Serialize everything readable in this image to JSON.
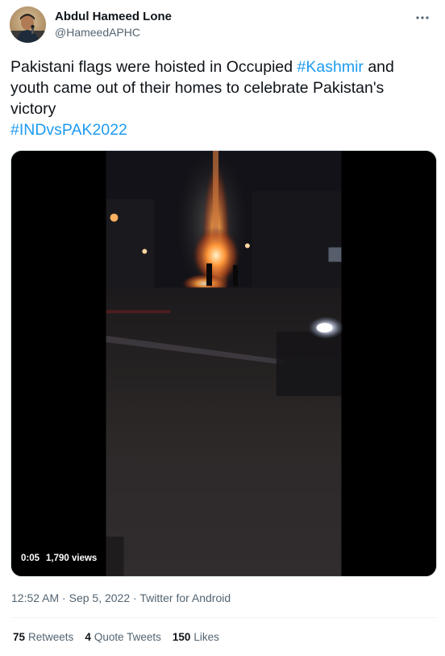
{
  "author": {
    "display_name": "Abdul Hameed Lone",
    "handle": "@HameedAPHC"
  },
  "tweet": {
    "text_part1": "Pakistani flags were hoisted in Occupied ",
    "hashtag1": "#Kashmir",
    "text_part2": " and",
    "text_line2": "youth came out of their homes to celebrate Pakistan's",
    "text_line3": "victory",
    "hashtag2": "#INDvsPAK2022"
  },
  "video": {
    "duration": "0:05",
    "views": "1,790 views"
  },
  "meta": {
    "time": "12:52 AM",
    "separator1": " · ",
    "date": "Sep 5, 2022",
    "separator2": " · ",
    "source": "Twitter for Android"
  },
  "stats": {
    "retweets_count": "75",
    "retweets_label": "Retweets",
    "quotes_count": "4",
    "quotes_label": "Quote Tweets",
    "likes_count": "150",
    "likes_label": "Likes"
  },
  "icons": {
    "more": "more-horizontal-icon"
  },
  "colors": {
    "accent": "#1d9bf0",
    "secondary_text": "#536471",
    "primary_text": "#0f1419"
  }
}
